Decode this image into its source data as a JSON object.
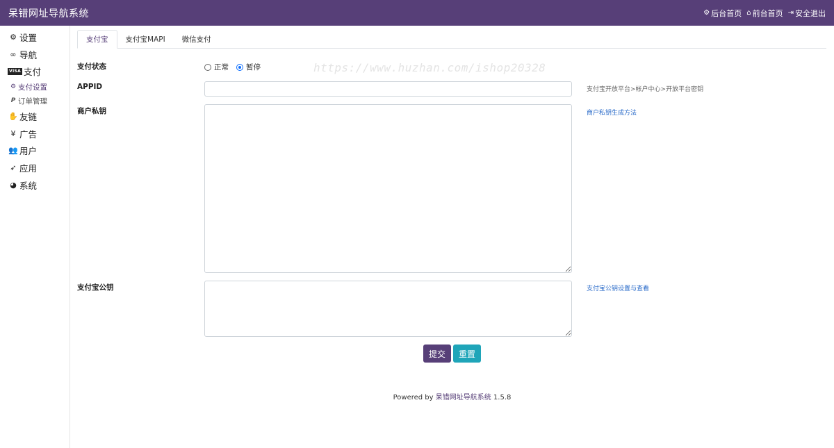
{
  "header": {
    "brand": "呆错网址导航系统",
    "links": [
      {
        "icon": "gear-icon",
        "label": "后台首页"
      },
      {
        "icon": "home-icon",
        "label": "前台首页"
      },
      {
        "icon": "sign-out-icon",
        "label": "安全退出"
      }
    ]
  },
  "sidebar": {
    "items": [
      {
        "icon": "cogs-icon",
        "label": "设置"
      },
      {
        "icon": "link-icon",
        "label": "导航"
      },
      {
        "icon": "visa-card-icon",
        "icon_text": "VISA",
        "label": "支付"
      },
      {
        "icon": "handshake-icon",
        "label": "友链"
      },
      {
        "icon": "yen-icon",
        "label": "广告"
      },
      {
        "icon": "users-icon",
        "label": "用户"
      },
      {
        "icon": "rocket-icon",
        "label": "应用"
      },
      {
        "icon": "dashboard-icon",
        "label": "系统"
      }
    ],
    "sub_items": [
      {
        "icon": "gear-icon",
        "label": "支付设置",
        "active": true
      },
      {
        "icon": "paypal-icon",
        "label": "订单管理",
        "active": false
      }
    ]
  },
  "tabs": [
    {
      "label": "支付宝",
      "active": true
    },
    {
      "label": "支付宝MAPI",
      "active": false
    },
    {
      "label": "微信支付",
      "active": false
    }
  ],
  "form": {
    "status": {
      "label": "支付状态",
      "options": [
        {
          "label": "正常",
          "checked": false
        },
        {
          "label": "暂停",
          "checked": true
        }
      ]
    },
    "appid": {
      "label": "APPID",
      "value": "",
      "hint": "支付宝开放平台>帐户中心>开放平台密钥"
    },
    "private_key": {
      "label": "商户私钥",
      "value": "",
      "hint": "商户私钥生成方法"
    },
    "public_key": {
      "label": "支付宝公钥",
      "value": "",
      "hint": "支付宝公钥设置与查看"
    },
    "submit_label": "提交",
    "reset_label": "重置"
  },
  "watermark": "https://www.huzhan.com/ishop20328",
  "footer": {
    "prefix": "Powered by",
    "product": "呆错网址导航系统",
    "version": "1.5.8"
  },
  "colors": {
    "brand": "#573f78",
    "reset_button": "#1fa5b9",
    "link": "#2a6bc9",
    "radio_checked": "#0d6efd"
  }
}
